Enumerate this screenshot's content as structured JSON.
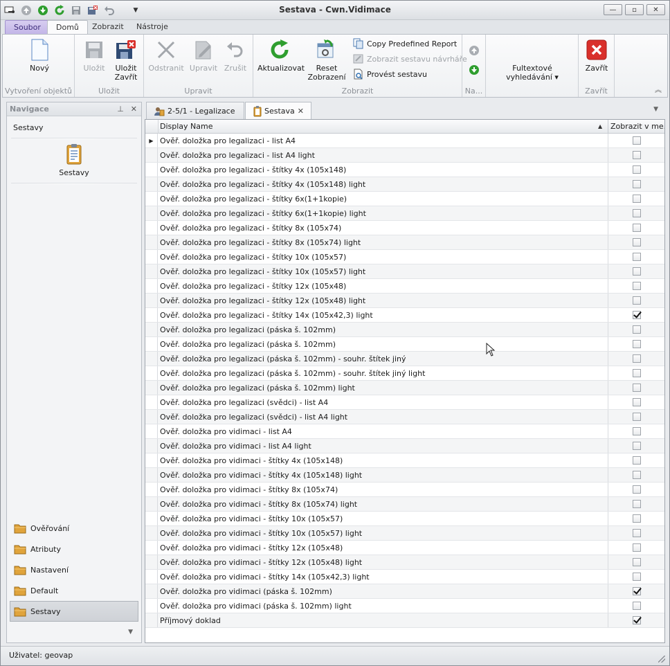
{
  "window": {
    "title": "Sestava - Cwn.Vidimace",
    "controls": {
      "minimize": "—",
      "maximize": "▫",
      "close": "✕"
    }
  },
  "ribbon": {
    "tabs": [
      {
        "label": "Soubor"
      },
      {
        "label": "Domů"
      },
      {
        "label": "Zobrazit"
      },
      {
        "label": "Nástroje"
      }
    ],
    "groups": {
      "create": {
        "label": "Vytvoření objektů",
        "new": "Nový"
      },
      "save": {
        "label": "Uložit",
        "save": "Uložit",
        "save_close_1": "Uložit",
        "save_close_2": "Zavřít"
      },
      "edit": {
        "label": "Upravit",
        "delete": "Odstranit",
        "edit": "Upravit",
        "undo": "Zrušit"
      },
      "view": {
        "label": "Zobrazit",
        "refresh": "Aktualizovat",
        "reset_1": "Reset",
        "reset_2": "Zobrazení",
        "copy_report": "Copy Predefined Report",
        "show_designer": "Zobrazit sestavu návrháře",
        "run_report": "Provést sestavu"
      },
      "na": {
        "label": "Na..."
      },
      "fulltext": {
        "label_1": "Fultextové",
        "label_2": "vyhledávání ▾"
      },
      "close": {
        "label": "Zavřít",
        "button": "Zavřít"
      }
    }
  },
  "navigation": {
    "title": "Navigace",
    "section": "Sestavy",
    "tile": "Sestavy",
    "groups": [
      {
        "label": "Ověřování"
      },
      {
        "label": "Atributy"
      },
      {
        "label": "Nastavení"
      },
      {
        "label": "Default"
      },
      {
        "label": "Sestavy"
      }
    ]
  },
  "document_tabs": [
    {
      "label": "2-5/1 - Legalizace"
    },
    {
      "label": "Sestava"
    }
  ],
  "grid": {
    "columns": {
      "name": "Display Name",
      "show": "Zobrazit v me..."
    },
    "rows": [
      {
        "name": "Ověř. doložka pro legalizaci - list A4",
        "checked": false
      },
      {
        "name": "Ověř. doložka pro legalizaci - list A4 light",
        "checked": false
      },
      {
        "name": "Ověř. doložka pro legalizaci - štítky  4x (105x148)",
        "checked": false
      },
      {
        "name": "Ověř. doložka pro legalizaci - štítky  4x (105x148) light",
        "checked": false
      },
      {
        "name": "Ověř. doložka pro legalizaci - štítky  6x(1+1kopie)",
        "checked": false
      },
      {
        "name": "Ověř. doložka pro legalizaci - štítky  6x(1+1kopie) light",
        "checked": false
      },
      {
        "name": "Ověř. doložka pro legalizaci - štítky  8x (105x74)",
        "checked": false
      },
      {
        "name": "Ověř. doložka pro legalizaci - štítky  8x (105x74) light",
        "checked": false
      },
      {
        "name": "Ověř. doložka pro legalizaci - štítky 10x (105x57)",
        "checked": false
      },
      {
        "name": "Ověř. doložka pro legalizaci - štítky 10x (105x57) light",
        "checked": false
      },
      {
        "name": "Ověř. doložka pro legalizaci - štítky 12x (105x48)",
        "checked": false
      },
      {
        "name": "Ověř. doložka pro legalizaci - štítky 12x (105x48) light",
        "checked": false
      },
      {
        "name": "Ověř. doložka pro legalizaci - štítky 14x (105x42,3) light",
        "checked": true
      },
      {
        "name": "Ověř. doložka pro legalizaci (páska š. 102mm)",
        "checked": false
      },
      {
        "name": "Ověř. doložka pro legalizaci (páska š. 102mm)",
        "checked": false
      },
      {
        "name": "Ověř. doložka pro legalizaci (páska š. 102mm) - souhr. štítek jiný",
        "checked": false
      },
      {
        "name": "Ověř. doložka pro legalizaci (páska š. 102mm) - souhr. štítek jiný light",
        "checked": false
      },
      {
        "name": "Ověř. doložka pro legalizaci (páska š. 102mm) light",
        "checked": false
      },
      {
        "name": "Ověř. doložka pro legalizaci (svědci) - list A4",
        "checked": false
      },
      {
        "name": "Ověř. doložka pro legalizaci (svědci) - list A4 light",
        "checked": false
      },
      {
        "name": "Ověř. doložka pro vidimaci - list A4",
        "checked": false
      },
      {
        "name": "Ověř. doložka pro vidimaci - list A4 light",
        "checked": false
      },
      {
        "name": "Ověř. doložka pro vidimaci - štítky  4x (105x148)",
        "checked": false
      },
      {
        "name": "Ověř. doložka pro vidimaci - štítky  4x (105x148) light",
        "checked": false
      },
      {
        "name": "Ověř. doložka pro vidimaci - štítky  8x (105x74)",
        "checked": false
      },
      {
        "name": "Ověř. doložka pro vidimaci - štítky  8x (105x74) light",
        "checked": false
      },
      {
        "name": "Ověř. doložka pro vidimaci - štítky 10x (105x57)",
        "checked": false
      },
      {
        "name": "Ověř. doložka pro vidimaci - štítky 10x (105x57) light",
        "checked": false
      },
      {
        "name": "Ověř. doložka pro vidimaci - štítky 12x (105x48)",
        "checked": false
      },
      {
        "name": "Ověř. doložka pro vidimaci - štítky 12x (105x48) light",
        "checked": false
      },
      {
        "name": "Ověř. doložka pro vidimaci - štítky 14x (105x42,3) light",
        "checked": false
      },
      {
        "name": "Ověř. doložka pro vidimaci (páska š. 102mm)",
        "checked": true
      },
      {
        "name": "Ověř. doložka pro vidimaci (páska š. 102mm) light",
        "checked": false
      },
      {
        "name": "Příjmový doklad",
        "checked": true
      }
    ]
  },
  "status": {
    "user": "Uživatel: geovap"
  },
  "icons": {
    "app": "app-icon",
    "back": "back-icon",
    "forward": "forward-icon",
    "refresh": "refresh-icon",
    "save": "save-icon",
    "save_close": "save-close-icon",
    "undo": "undo-icon",
    "customize": "customize-icon",
    "folder": "folder-icon",
    "report": "report-icon",
    "close": "close-icon"
  },
  "colors": {
    "accent_green": "#2f9e2f",
    "close_red": "#d9302b",
    "file_tab": "#c3b6e8",
    "folder": "#e0a43c"
  }
}
